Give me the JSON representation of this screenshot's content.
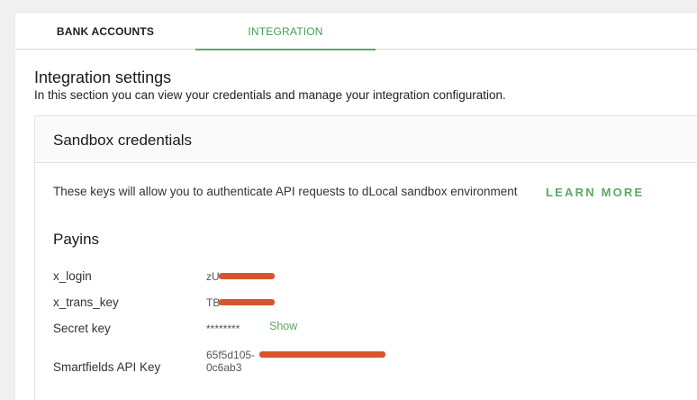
{
  "tabs": [
    {
      "label": "BANK ACCOUNTS",
      "active": false
    },
    {
      "label": "INTEGRATION",
      "active": true
    }
  ],
  "header": {
    "title": "Integration settings",
    "subtitle": "In this section you can view your credentials and manage your integration configuration."
  },
  "sandbox": {
    "title": "Sandbox credentials",
    "info_text": "These keys will allow you to authenticate API requests to dLocal sandbox environment",
    "learn_more_label": "LEARN MORE",
    "section_title": "Payins",
    "rows": {
      "login": {
        "label": "x_login",
        "value": "zU"
      },
      "trans_key": {
        "label": "x_trans_key",
        "value": "TB"
      },
      "secret": {
        "label": "Secret key",
        "value": "********",
        "show_label": "Show"
      },
      "smartfields": {
        "label": "Smartfields API Key",
        "value_line1": "65f5d105-",
        "value_line2": "0c6ab3"
      }
    }
  },
  "colors": {
    "accent": "#5ea765",
    "redaction": "#d9542b"
  }
}
